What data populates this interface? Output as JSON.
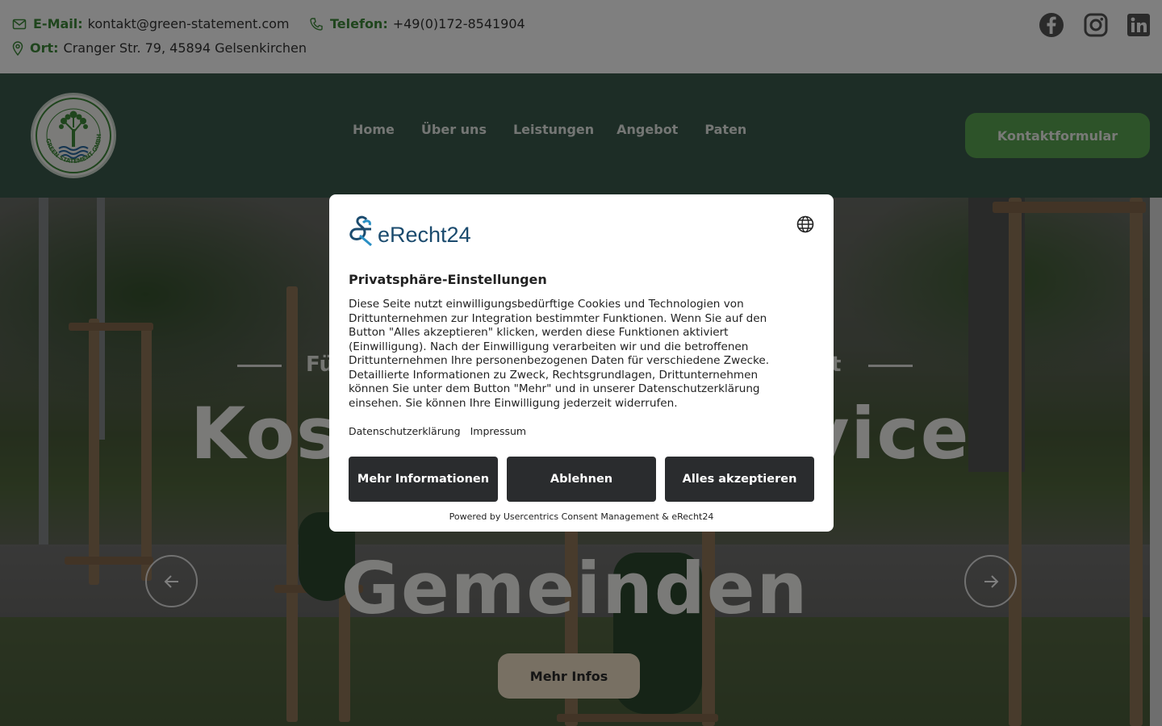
{
  "topbar": {
    "email_label": "E-Mail:",
    "email_value": "kontakt@green-statement.com",
    "phone_label": "Telefon:",
    "phone_value": "+49(0)172-8541904",
    "location_label": "Ort:",
    "location_value": "Cranger Str. 79, 45894 Gelsenkirchen",
    "social_icons": [
      "facebook-icon",
      "instagram-icon",
      "linkedin-icon"
    ]
  },
  "header": {
    "logo_text": "GREEN STATEMENT GMBH",
    "nav": [
      "Home",
      "Über uns",
      "Leistungen",
      "Angebot",
      "Paten"
    ],
    "cta": "Kontaktformular"
  },
  "hero": {
    "kicker_left": "Fü",
    "kicker_right": "t",
    "title_line1_left": "Kos",
    "title_line1_right": "vice",
    "title_line3": "Gemeinden",
    "button": "Mehr Infos"
  },
  "consent": {
    "brand": "eRecht24",
    "title": "Privatsphäre-Einstellungen",
    "body": "Diese Seite nutzt einwilligungsbedürftige Cookies und Technologien von Drittunternehmen zur Integration bestimmter Funktionen. Wenn Sie auf den Button \"Alles akzeptieren\" klicken, werden diese Funktionen aktiviert (Einwilligung). Nach der Einwilligung verarbeiten wir und die betroffenen Drittunternehmen Ihre personenbezogenen Daten für verschiedene Zwecke. Detaillierte Informationen zu Zweck, Rechtsgrundlagen, Drittunternehmen können Sie unter dem Button \"Mehr\" und in unserer Datenschutzerklärung einsehen. Sie können Ihre Einwilligung jederzeit widerrufen.",
    "link_privacy": "Datenschutzerklärung",
    "link_imprint": "Impressum",
    "btn_more": "Mehr Informationen",
    "btn_decline": "Ablehnen",
    "btn_accept": "Alles akzeptieren",
    "powered_by": "Powered by Usercentrics Consent Management & eRecht24"
  },
  "colors": {
    "accent_green": "#3f8a3a",
    "header_bg": "#3b5b4d",
    "cta_bg": "#5aa652",
    "hero_button_bg": "#f0e0c6",
    "modal_button_bg": "#2a2c2e"
  }
}
